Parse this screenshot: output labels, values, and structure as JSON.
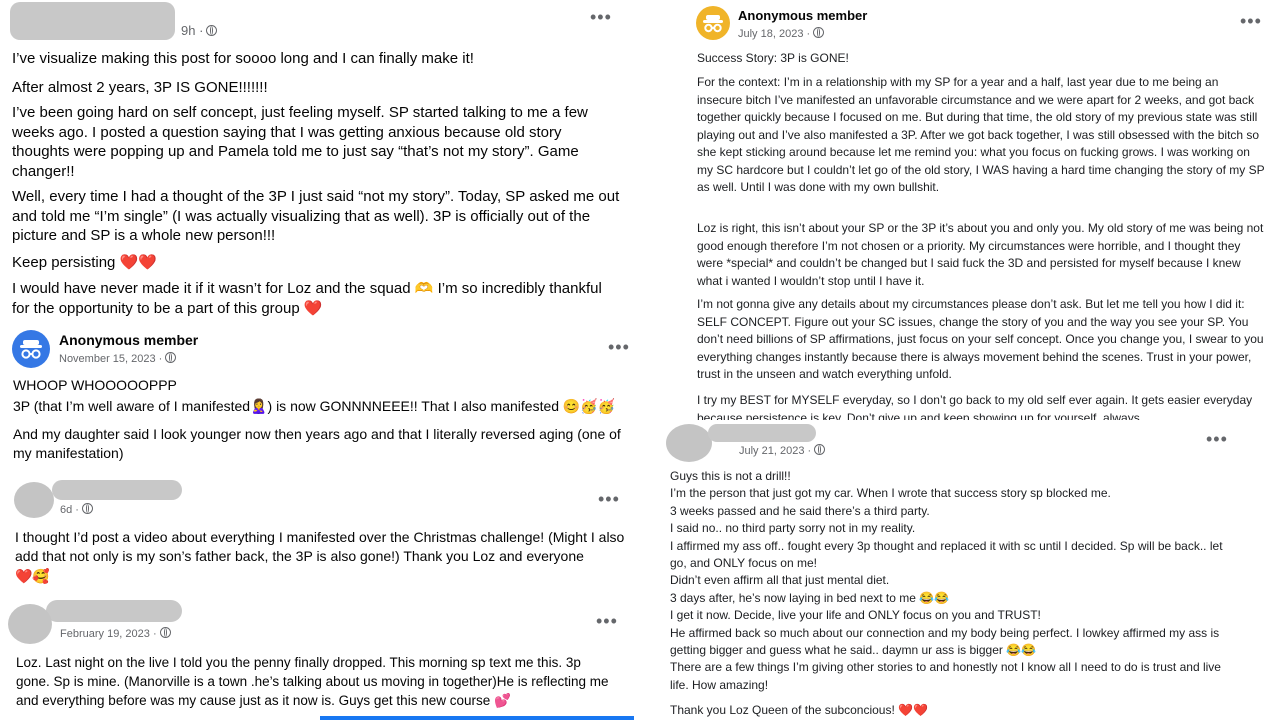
{
  "post1": {
    "time": "9h ·",
    "paragraphs": [
      "I’ve visualize making this post for soooo long and I can finally make it!",
      "After almost 2 years, 3P IS GONE!!!!!!!",
      "I’ve been going hard on self concept, just feeling myself. SP started talking to me a few weeks ago. I posted a question saying that I was getting anxious because old story thoughts were popping up and Pamela told me to just say “that’s not my story”. Game changer!!",
      "Well, every time I had a thought of the 3P I just said “not my story”. Today, SP asked me out and told me “I’m single” (I was actually visualizing that as well). 3P is officially out of the picture and SP is a whole new person!!!",
      "I would have never made it if it wasn’t for Loz and the squad",
      "I’m so incredibly thankful for the opportunity to be a part of this group"
    ],
    "keep_persisting": "Keep persisting",
    "hearts": "❤️❤️",
    "heart_single": "❤️",
    "hands_emoji": "🫶"
  },
  "post2": {
    "author": "Anonymous member",
    "date": "November 15, 2023 ·",
    "line1": "WHOOP WHOOOOOPPP",
    "line2a": "3P (that I’m well aware of I manifested",
    "line2_emoji1": "🙎‍♀️",
    "line2b": ") is now GONNNNEEE!! That I also manifested",
    "line2_emoji2": "😊🥳🥳",
    "line3": "And my daughter said I look younger now then years ago and that I literally reversed aging (one of my manifestation)"
  },
  "post3": {
    "time": "6d ·",
    "text": "I thought I’d post a video about everything I manifested over the Christmas challenge! (Might I also add that not only is my son’s father back, the 3P is also gone!) Thank you Loz and everyone",
    "emoji": "❤️🥰"
  },
  "post4": {
    "date": "February 19, 2023 ·",
    "text": "Loz. Last night on the live I told you the penny finally dropped. This morning sp text me this. 3p gone. Sp is mine. (Manorville is a town .he’s talking about us moving in together)He is reflecting me and everything before was my cause just as it now is. Guys get this new course",
    "emoji": "💕"
  },
  "post5": {
    "author": "Anonymous member",
    "date": "July 18, 2023 ·",
    "paragraphs": [
      "Success Story: 3P is GONE!",
      "For the context: I’m in a relationship with my SP for a year and a half, last year due to me being an insecure bitch I’ve manifested an unfavorable circumstance and we were apart for 2 weeks, and got back together quickly because I focused on me. But during that time, the old story of my previous state was still playing out and I’ve also manifested a 3P. After we got back together, I was still obsessed with the bitch so she kept sticking around because let me remind you: what you focus on fucking grows. I was working on my SC hardcore but I couldn’t let go of the old story, I WAS having a hard time changing the story of my SP as well. Until I was done with my own bullshit.",
      "Loz is right, this isn’t about your SP or the 3P it’s about you and only you. My old story of me was being not good enough therefore I’m not chosen or a priority. My circumstances were horrible, and I thought they were *special* and couldn’t be changed but I said fuck the 3D and persisted for myself because I knew what i wanted I wouldn’t stop until I have it.",
      "I’m not gonna give any details about my circumstances please don’t ask. But let me tell you how I did it: SELF CONCEPT. Figure out your SC issues, change the story of you and the way you see your SP. You don’t need billions of SP affirmations, just focus on your self concept. Once you change you, I swear to you everything changes instantly because there is always movement behind the scenes. Trust in your power, trust in the unseen and watch everything unfold.",
      "I try my BEST for MYSELF everyday, so I don’t go back to my old self ever again. It gets easier everyday because persistence is key. Don’t give up and keep showing up for yourself, always."
    ]
  },
  "post6": {
    "date": "July 21, 2023 ·",
    "lines": [
      "Guys this is not a drill!!",
      "I’m the person that just got my car. When I wrote that success story sp blocked me.",
      "3 weeks passed and he said there’s a third party.",
      "I said no.. no third party sorry not in my reality.",
      "I affirmed my ass off.. fought every 3p thought and replaced it with sc until I decided. Sp will be back.. let go, and ONLY focus on me!",
      "Didn’t even affirm all that just mental diet.",
      "3 days after, he’s now laying in bed next to me",
      "I get it now. Decide, live your life and ONLY focus on you and TRUST!",
      "He affirmed back so much about our connection and my body being perfect. I lowkey affirmed my ass is getting bigger and guess what he said.. daymn ur ass is bigger",
      "There are a few things I’m giving other stories to and honestly not I know all I need to do is trust and live life. How amazing!"
    ],
    "laugh_emoji": "😂😂",
    "closing": "Thank you Loz Queen of the subconcious!",
    "closing_emoji": "❤️❤️"
  }
}
